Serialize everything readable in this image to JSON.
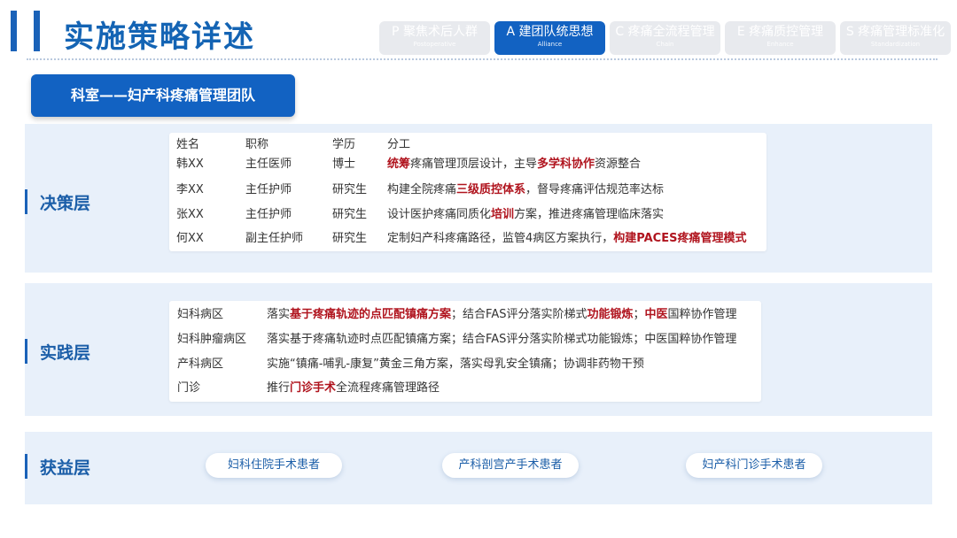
{
  "page_title": "实施策略详述",
  "tabs": [
    {
      "label": "P 聚焦术后人群",
      "sub": "Postoperative",
      "active": false
    },
    {
      "label": "A 建团队统思想",
      "sub": "Alliance",
      "active": true
    },
    {
      "label": "C 疼痛全流程管理",
      "sub": "Chain",
      "active": false
    },
    {
      "label": "E 疼痛质控管理",
      "sub": "Enhance",
      "active": false
    },
    {
      "label": "S 疼痛管理标准化",
      "sub": "Standardization",
      "active": false
    }
  ],
  "section_title": "科室——妇产科疼痛管理团队",
  "decision": {
    "label": "决策层",
    "header": {
      "name": "姓名",
      "title": "职称",
      "edu": "学历",
      "duty": "分工"
    },
    "rows": [
      {
        "name": "韩XX",
        "title": "主任医师",
        "edu": "博士",
        "duty": [
          {
            "t": "统筹",
            "h": true
          },
          {
            "t": "疼痛管理顶层设计，主导",
            "h": false
          },
          {
            "t": "多学科协作",
            "h": true
          },
          {
            "t": "资源整合",
            "h": false
          }
        ]
      },
      {
        "name": "李XX",
        "title": "主任护师",
        "edu": "研究生",
        "duty": [
          {
            "t": "构建全院疼痛",
            "h": false
          },
          {
            "t": "三级质控体系",
            "h": true
          },
          {
            "t": "，督导疼痛评估规范率达标",
            "h": false
          }
        ]
      },
      {
        "name": "张XX",
        "title": "主任护师",
        "edu": "研究生",
        "duty": [
          {
            "t": "设计医护疼痛同质化",
            "h": false
          },
          {
            "t": "培训",
            "h": true
          },
          {
            "t": "方案，推进疼痛管理临床落实",
            "h": false
          }
        ]
      },
      {
        "name": "何XX",
        "title": "副主任护师",
        "edu": "研究生",
        "duty": [
          {
            "t": "定制妇产科疼痛路径，监管4病区方案执行，",
            "h": false
          },
          {
            "t": "构建PACES疼痛管理模式",
            "h": true
          }
        ]
      }
    ]
  },
  "practice": {
    "label": "实践层",
    "rows": [
      {
        "ward": "妇科病区",
        "plan": [
          {
            "t": "落实",
            "h": false
          },
          {
            "t": "基于疼痛轨迹的点匹配镇痛方案",
            "h": true
          },
          {
            "t": "；结合FAS评分落实阶梯式",
            "h": false
          },
          {
            "t": "功能锻炼",
            "h": true
          },
          {
            "t": "；",
            "h": false
          },
          {
            "t": "中医",
            "h": true
          },
          {
            "t": "国粹协作管理",
            "h": false
          }
        ]
      },
      {
        "ward": "妇科肿瘤病区",
        "plan": [
          {
            "t": "落实基于疼痛轨迹时点匹配镇痛方案；结合FAS评分落实阶梯式功能锻炼；中医国粹协作管理",
            "h": false
          }
        ]
      },
      {
        "ward": "产科病区",
        "plan": [
          {
            "t": "实施“镇痛-哺乳-康复”黄金三角方案，落实母乳安全镇痛；协调非药物干预",
            "h": false
          }
        ]
      },
      {
        "ward": "门诊",
        "plan": [
          {
            "t": "推行",
            "h": false
          },
          {
            "t": "门诊手术",
            "h": true
          },
          {
            "t": "全流程疼痛管理路径",
            "h": false
          }
        ]
      }
    ]
  },
  "benefit": {
    "label": "获益层",
    "items": [
      "妇科住院手术患者",
      "产科剖宫产手术患者",
      "妇产科门诊手术患者"
    ]
  },
  "colors": {
    "primary": "#1262c2",
    "highlight": "#b0141e",
    "panel_bg": "#e8f0fa"
  }
}
